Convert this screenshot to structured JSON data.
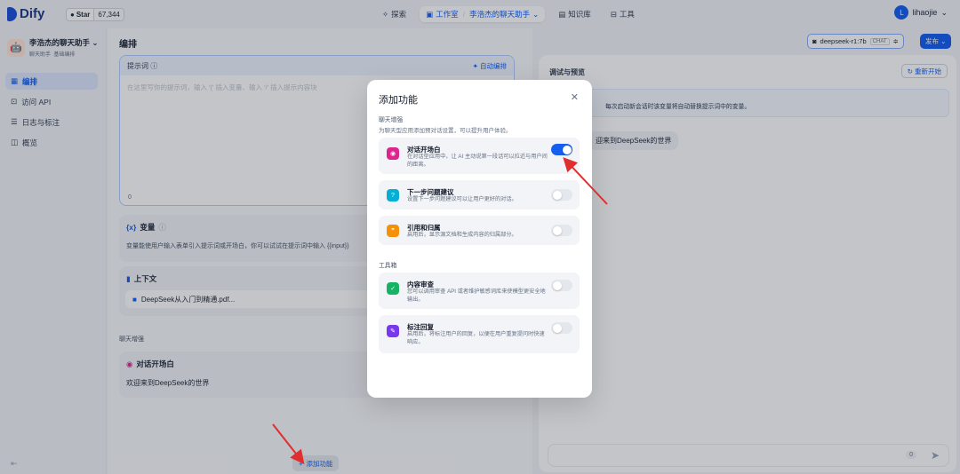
{
  "brand": {
    "name": "Dify"
  },
  "github": {
    "label": "Star",
    "count": "67,344"
  },
  "nav": {
    "explore": "探索",
    "studio": "工作室",
    "app": "李浩杰的聊天助手",
    "knowledge": "知识库",
    "tools": "工具"
  },
  "user": {
    "initial": "L",
    "name": "lihaojie"
  },
  "app": {
    "name": "李浩杰的聊天助手",
    "tag1": "聊天助手",
    "tag2": "基础编排"
  },
  "sidebar": {
    "items": [
      {
        "label": "编排"
      },
      {
        "label": "访问 API"
      },
      {
        "label": "日志与标注"
      },
      {
        "label": "概览"
      }
    ]
  },
  "main": {
    "title": "编排",
    "prompt_label": "提示词",
    "auto_label": "自动编排",
    "prompt_placeholder": "在这里写你的提示词，输入 '{' 插入变量、输入 '/' 插入提示内容块",
    "prompt_count": "0",
    "vars_title": "变量",
    "vars_desc": "变量能使用户输入表单引入提示词或开场白，你可以试试在提示词中输入 {{input}}",
    "context_title": "上下文",
    "context_file": "DeepSeek从入门到精通.pdf...",
    "section_label": "聊天增强",
    "opening_title": "对话开场白",
    "opening_text": "欢迎来到DeepSeek的世界",
    "add_feature": "添加功能"
  },
  "model": {
    "name": "deepseek-r1:7b",
    "badge": "CHAT"
  },
  "publish": "发布",
  "debug": {
    "title": "调试与预览",
    "restart": "重新开始",
    "hint": "每次启动新会话时该变量将自动替换提示词中的变量。",
    "welcome_bubble": "迎来到DeepSeek的世界",
    "input_count": "0"
  },
  "modal": {
    "title": "添加功能",
    "group1": "聊天增强",
    "group1_desc": "为聊天型应用添加预对话设置，可以提升用户体验。",
    "group2": "工具箱",
    "features": [
      {
        "name": "对话开场白",
        "desc": "在对话型应用中，让 AI 主动说第一段话可以拉近与用户间的距离。",
        "on": true,
        "color": "#dd2590"
      },
      {
        "name": "下一步问题建议",
        "desc": "设置下一步问题建议可以让用户更好的对话。",
        "on": false,
        "color": "#06aed4"
      },
      {
        "name": "引用和归属",
        "desc": "启用后，显示源文档和生成内容的归属部分。",
        "on": false,
        "color": "#f79009"
      },
      {
        "name": "内容审查",
        "desc": "您可以调用审查 API 或者维护敏感词库来使模型更安全地输出。",
        "on": false,
        "color": "#16b364"
      },
      {
        "name": "标注回复",
        "desc": "启用后，将标注用户的回复，以便在用户重复提问时快速响应。",
        "on": false,
        "color": "#7839ee"
      }
    ]
  },
  "colors": {
    "accent": "#155eef",
    "annotation_arrow": "#e02d2d"
  }
}
